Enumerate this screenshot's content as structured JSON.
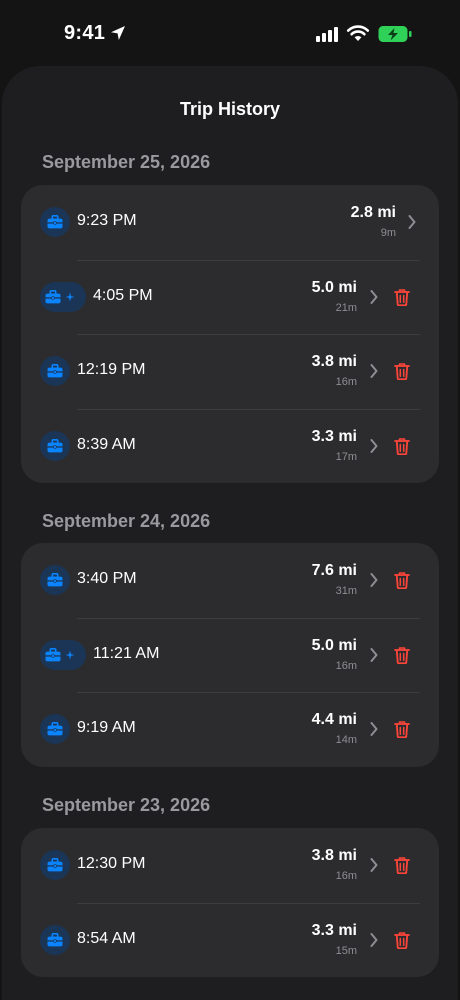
{
  "status_bar": {
    "time": "9:41"
  },
  "title": "Trip History",
  "sections": [
    {
      "date": "September 25, 2026",
      "trips": [
        {
          "time": "9:23 PM",
          "distance": "2.8 mi",
          "duration": "9m",
          "icon": "briefcase-icon",
          "added": false,
          "deletable": false
        },
        {
          "time": "4:05 PM",
          "distance": "5.0 mi",
          "duration": "21m",
          "icon": "briefcase-icon",
          "added": true,
          "deletable": true
        },
        {
          "time": "12:19 PM",
          "distance": "3.8 mi",
          "duration": "16m",
          "icon": "briefcase-icon",
          "added": false,
          "deletable": true
        },
        {
          "time": "8:39 AM",
          "distance": "3.3 mi",
          "duration": "17m",
          "icon": "briefcase-icon",
          "added": false,
          "deletable": true
        }
      ]
    },
    {
      "date": "September 24, 2026",
      "trips": [
        {
          "time": "3:40 PM",
          "distance": "7.6 mi",
          "duration": "31m",
          "icon": "briefcase-icon",
          "added": false,
          "deletable": true
        },
        {
          "time": "11:21 AM",
          "distance": "5.0 mi",
          "duration": "16m",
          "icon": "briefcase-icon",
          "added": true,
          "deletable": true
        },
        {
          "time": "9:19 AM",
          "distance": "4.4 mi",
          "duration": "14m",
          "icon": "briefcase-icon",
          "added": false,
          "deletable": true
        }
      ]
    },
    {
      "date": "September 23, 2026",
      "trips": [
        {
          "time": "12:30 PM",
          "distance": "3.8 mi",
          "duration": "16m",
          "icon": "briefcase-icon",
          "added": false,
          "deletable": true
        },
        {
          "time": "8:54 AM",
          "distance": "3.3 mi",
          "duration": "15m",
          "icon": "briefcase-icon",
          "added": false,
          "deletable": true
        }
      ]
    }
  ],
  "colors": {
    "accent_blue": "#0a84ff",
    "delete_red": "#ff453a",
    "card": "#2c2c2e",
    "sheet": "#1e1e20",
    "battery_green": "#30d158"
  }
}
